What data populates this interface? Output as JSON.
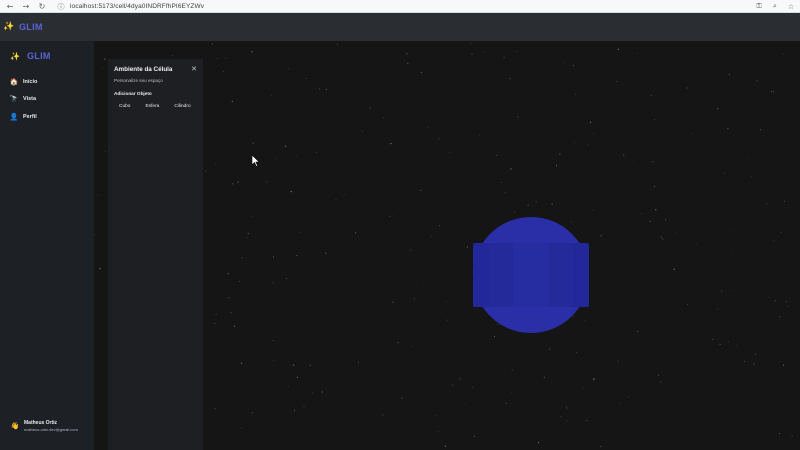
{
  "browser": {
    "back_glyph": "←",
    "forward_glyph": "→",
    "reload_glyph": "↻",
    "info_glyph": "ⓘ",
    "url": "localhost:5173/cell/4dya0INDRFfhPI6EYZWv",
    "right_icons": [
      "key-icon",
      "zoom-icon",
      "bookmark-star-icon"
    ],
    "key_glyph": "⚿",
    "zoom_glyph": "⌕",
    "star_glyph": "☆"
  },
  "header": {
    "logo_glyph": "✨",
    "logo_text": "GLIM"
  },
  "sidebar": {
    "logo_glyph": "✨",
    "logo_text": "GLIM",
    "items": [
      {
        "label": "Início",
        "icon": "home-icon",
        "glyph": "🏠",
        "color": "#d8a35c"
      },
      {
        "label": "Vista",
        "icon": "telescope-icon",
        "glyph": "🔭",
        "color": "#4f8fe0"
      },
      {
        "label": "Perfil",
        "icon": "person-icon",
        "glyph": "👤",
        "color": "#8a6fd4"
      }
    ],
    "user": {
      "avatar_glyph": "👋",
      "name": "Matheus Ortiz",
      "email": "matheus.ortiz.dev@gmail.com"
    }
  },
  "panel": {
    "title": "Ambiente da Célula",
    "close_glyph": "✕",
    "subtitle": "Personalize seu espaço",
    "section_title": "Adicionar Objeto",
    "buttons": [
      "Cubo",
      "Esfera",
      "Cilindro"
    ]
  },
  "scene": {
    "object_color": "#2a2fa8",
    "object_shade": "#252a9a",
    "background": "#151515"
  }
}
